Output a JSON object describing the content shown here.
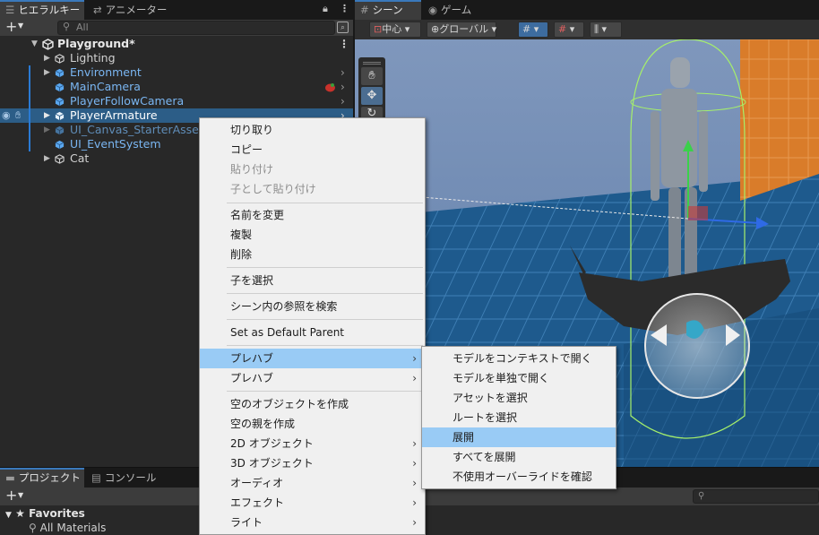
{
  "hierarchy": {
    "tab_label": "ヒエラルキー",
    "tab2_label": "アニメーター",
    "search_placeholder": "All",
    "scene_name": "Playground*",
    "items": [
      {
        "label": "Lighting"
      },
      {
        "label": "Environment"
      },
      {
        "label": "MainCamera"
      },
      {
        "label": "PlayerFollowCamera"
      },
      {
        "label": "PlayerArmature"
      },
      {
        "label": "UI_Canvas_StarterAsset"
      },
      {
        "label": "UI_EventSystem"
      },
      {
        "label": "Cat"
      }
    ]
  },
  "scene": {
    "tab_label": "シーン",
    "tab2_label": "ゲーム",
    "pivot_label": "中心",
    "space_label": "グローバル"
  },
  "project": {
    "tab_label": "プロジェクト",
    "tab2_label": "コンソール",
    "favorites_label": "Favorites",
    "all_materials_label": "All Materials"
  },
  "context_menu": {
    "items": [
      {
        "label": "切り取り"
      },
      {
        "label": "コピー"
      },
      {
        "label": "貼り付け"
      },
      {
        "label": "子として貼り付け"
      },
      {
        "label": "名前を変更"
      },
      {
        "label": "複製"
      },
      {
        "label": "削除"
      },
      {
        "label": "子を選択"
      },
      {
        "label": "シーン内の参照を検索"
      },
      {
        "label": "Set as Default Parent"
      },
      {
        "label": "プレハブ"
      },
      {
        "label": "プレハブ"
      },
      {
        "label": "空のオブジェクトを作成"
      },
      {
        "label": "空の親を作成"
      },
      {
        "label": "2D オブジェクト"
      },
      {
        "label": "3D オブジェクト"
      },
      {
        "label": "オーディオ"
      },
      {
        "label": "エフェクト"
      },
      {
        "label": "ライト"
      }
    ]
  },
  "submenu": {
    "items": [
      {
        "label": "モデルをコンテキストで開く"
      },
      {
        "label": "モデルを単独で開く"
      },
      {
        "label": "アセットを選択"
      },
      {
        "label": "ルートを選択"
      },
      {
        "label": "展開"
      },
      {
        "label": "すべてを展開"
      },
      {
        "label": "不使用オーバーライドを確認"
      }
    ]
  },
  "colors": {
    "selection": "#2c5d87",
    "prefab_text": "#7ab6f2",
    "menu_highlight": "#99cbf5",
    "accent_blue": "#3a79bb"
  }
}
